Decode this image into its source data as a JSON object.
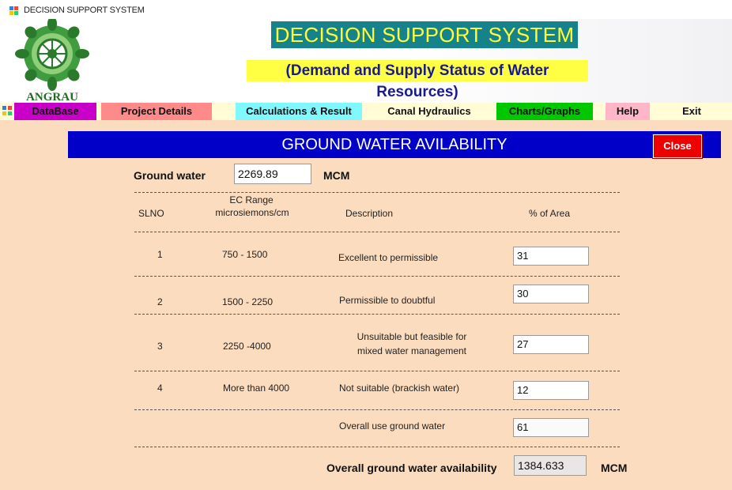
{
  "window": {
    "title": "DECISION SUPPORT SYSTEM"
  },
  "header": {
    "title": "DECISION SUPPORT SYSTEM",
    "subtitle": "(Demand and Supply Status of Water Resources)",
    "logo_text": "ANGRAU"
  },
  "menu": [
    {
      "label": "DataBase",
      "color": "#c800c8"
    },
    {
      "label": "Project Details",
      "color": "#ff8a8a"
    },
    {
      "label": "Calculations & Result",
      "color": "#7ff8ff"
    },
    {
      "label": "Canal Hydraulics",
      "color": "#fffcd6"
    },
    {
      "label": "Charts/Graphs",
      "color": "#00c800"
    },
    {
      "label": "Help",
      "color": "#ffb6c8"
    },
    {
      "label": "Exit",
      "color": "#fffcd6"
    }
  ],
  "form": {
    "banner_title": "GROUND WATER AVILABILITY",
    "close_label": "Close",
    "ground_water_label": "Ground water",
    "ground_water_value": "2269.89",
    "ground_water_unit": "MCM",
    "columns": {
      "slno": "SLNO",
      "ec_range_line1": "EC Range",
      "ec_range_line2": "microsiemons/cm",
      "description": "Description",
      "area": "% of Area"
    },
    "rows": [
      {
        "slno": "1",
        "ec": "750 - 1500",
        "desc1": "Excellent to permissible",
        "desc2": "",
        "area": "31"
      },
      {
        "slno": "2",
        "ec": "1500 - 2250",
        "desc1": "Permissible to doubtful",
        "desc2": "",
        "area": "30"
      },
      {
        "slno": "3",
        "ec": "2250 -4000",
        "desc1": "Unsuitable but feasible for",
        "desc2": "mixed water management",
        "area": "27"
      },
      {
        "slno": "4",
        "ec": "More than 4000",
        "desc1": "Not suitable (brackish water)",
        "desc2": "",
        "area": "12"
      }
    ],
    "overall_use_label": "Overall use ground water",
    "overall_use_value": "61",
    "overall_avail_label": "Overall ground water availability",
    "overall_avail_value": "1384.633",
    "overall_avail_unit": "MCM"
  }
}
